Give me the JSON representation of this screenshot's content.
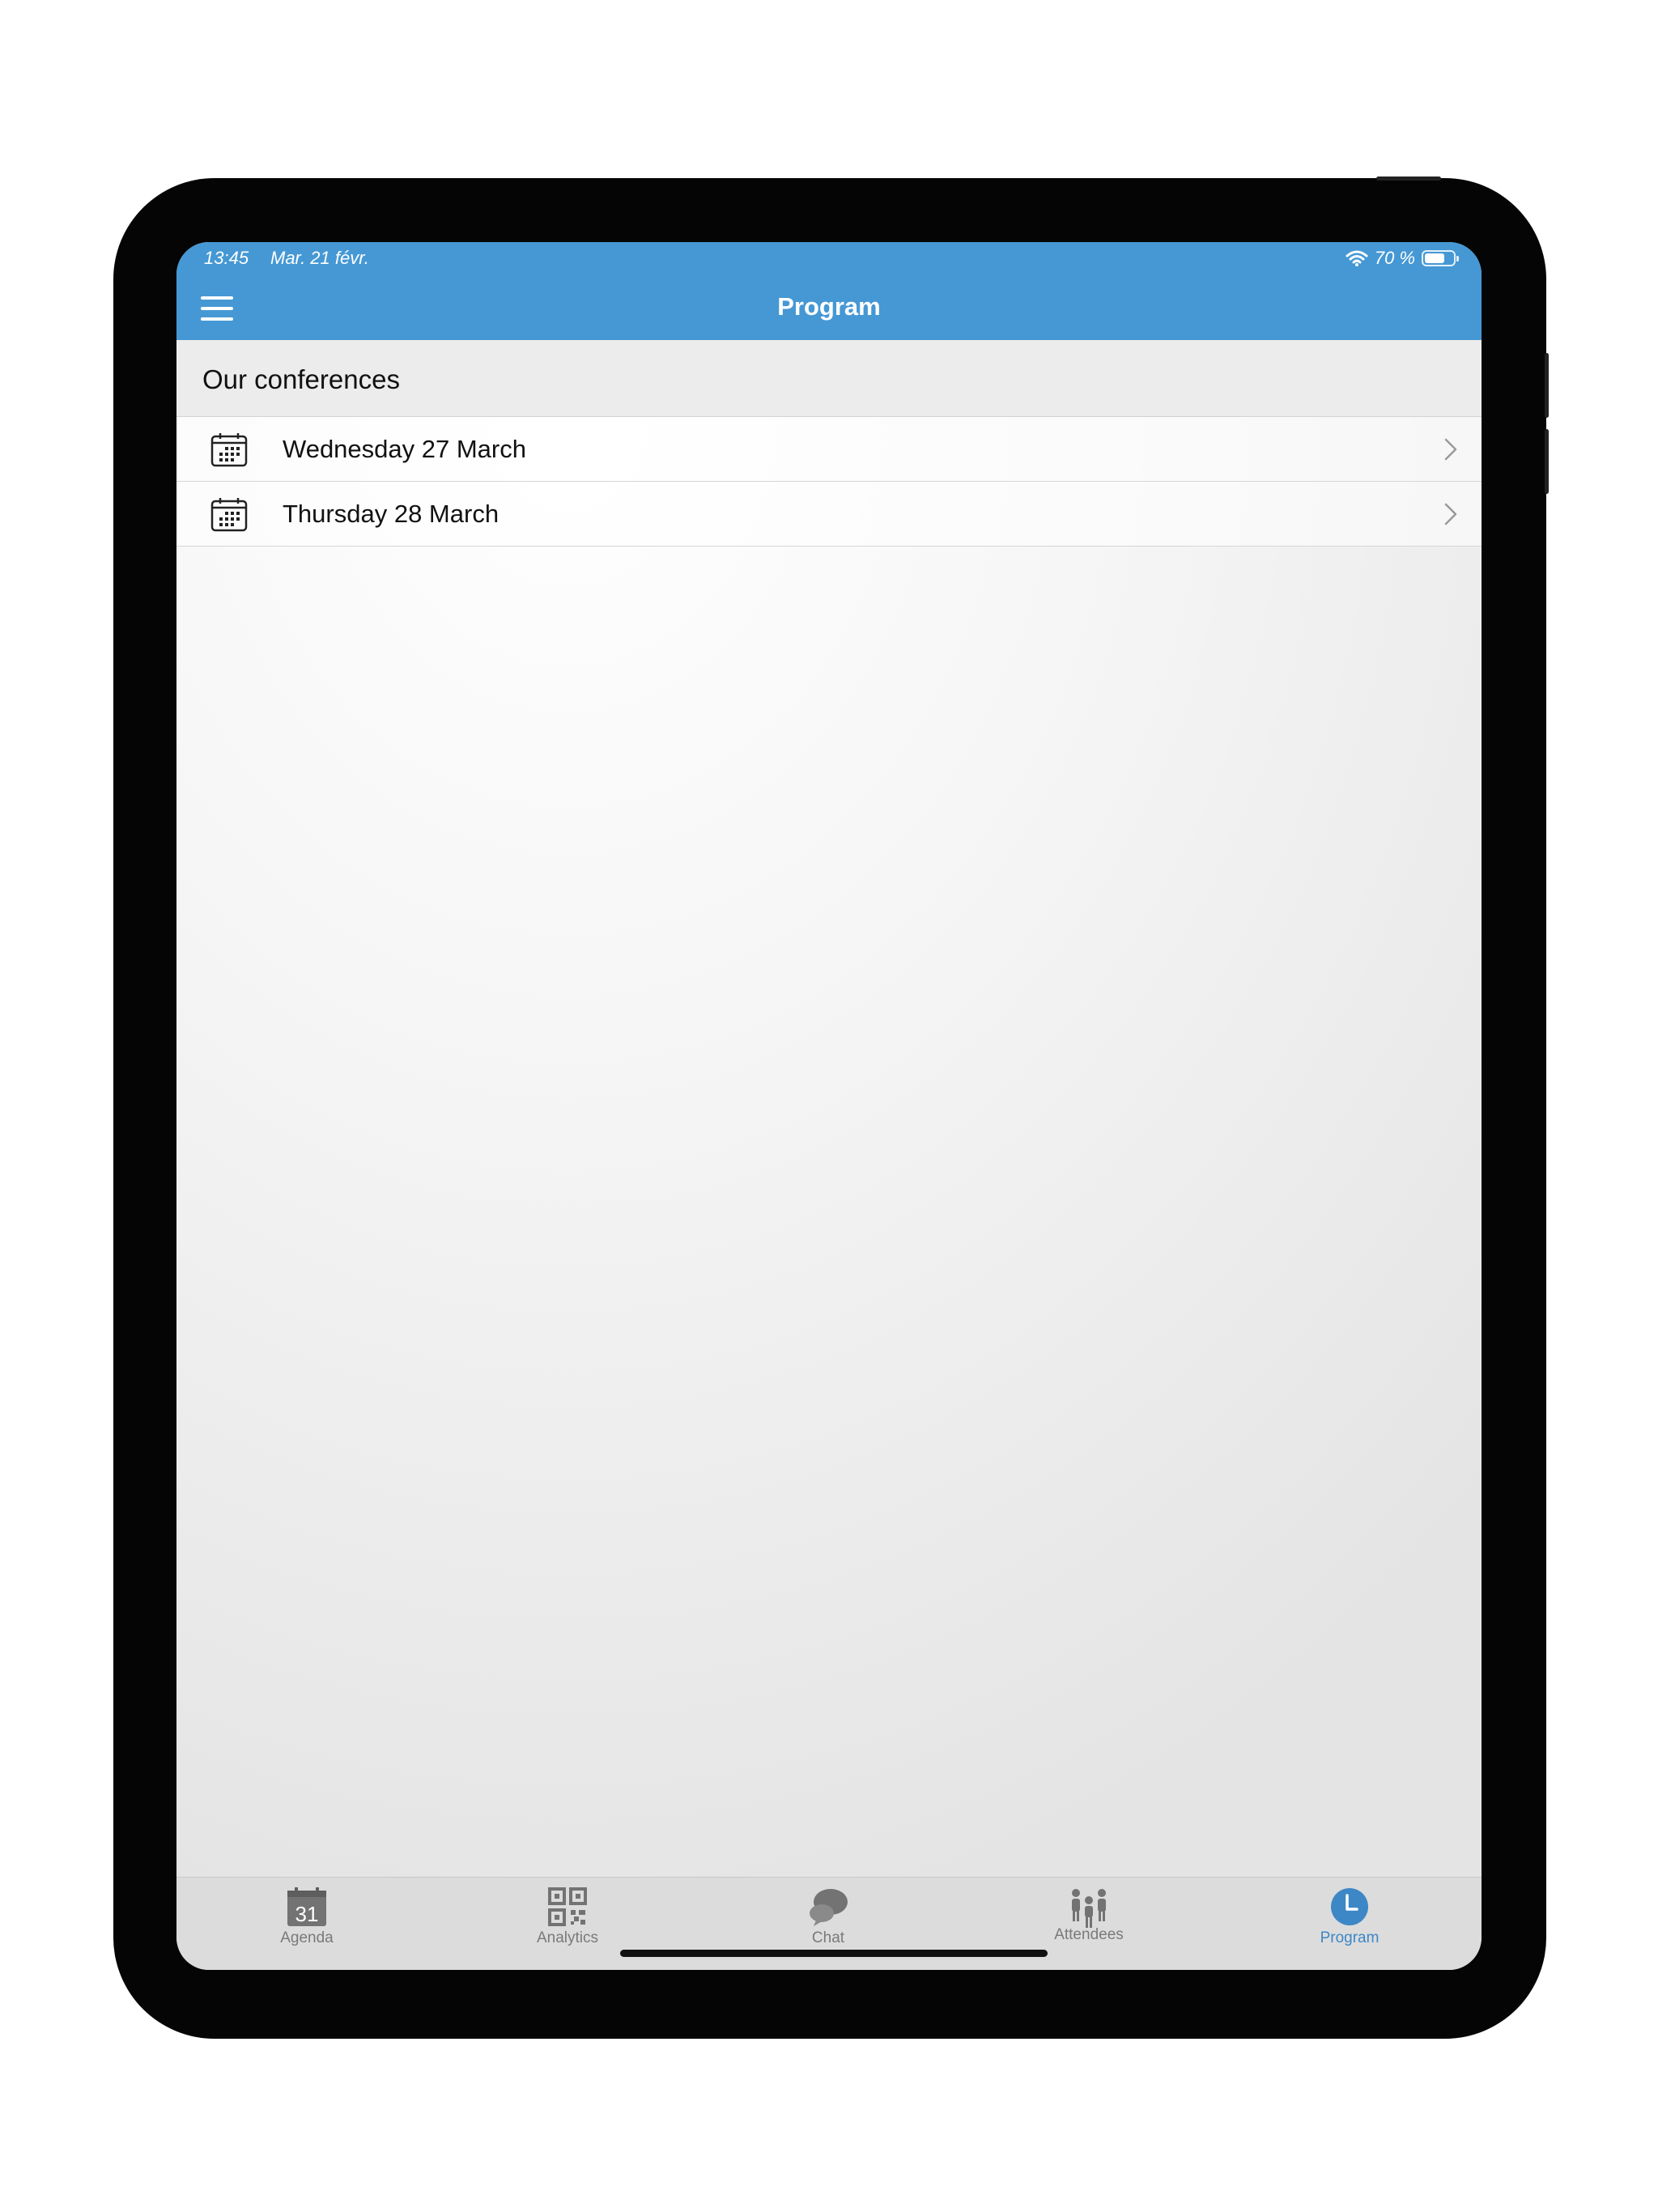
{
  "status_bar": {
    "time": "13:45",
    "date": "Mar. 21 févr.",
    "battery": "70 %",
    "battery_level": 0.7
  },
  "nav": {
    "title": "Program"
  },
  "section": {
    "title": "Our conferences"
  },
  "rows": [
    {
      "label": "Wednesday 27 March"
    },
    {
      "label": "Thursday 28 March"
    }
  ],
  "tabs": [
    {
      "label": "Agenda",
      "icon": "calendar-31-icon",
      "calendar_number": "31"
    },
    {
      "label": "Analytics",
      "icon": "qr-code-icon"
    },
    {
      "label": "Chat",
      "icon": "chat-bubbles-icon"
    },
    {
      "label": "Attendees",
      "icon": "people-icon"
    },
    {
      "label": "Program",
      "icon": "clock-icon",
      "active": true
    }
  ],
  "colors": {
    "accent": "#4598d4",
    "tab_active": "#3d87c6",
    "tab_inactive": "#7a7a7a"
  }
}
